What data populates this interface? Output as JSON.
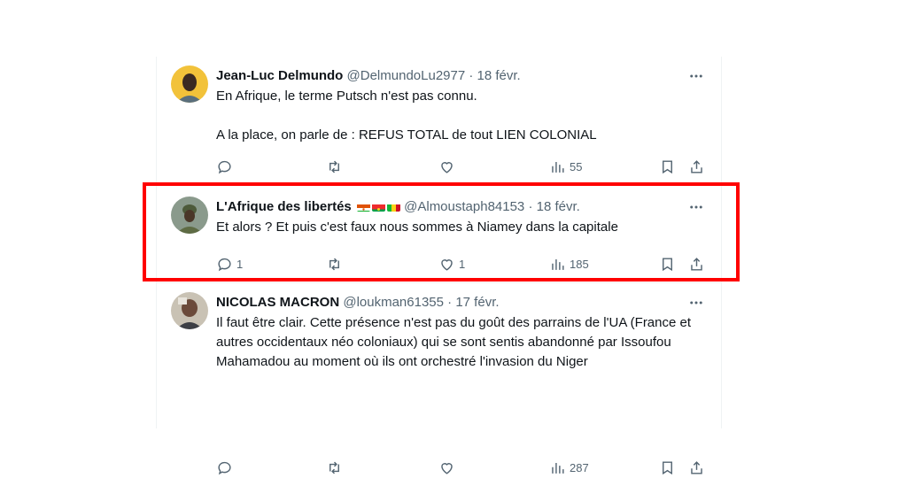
{
  "tweets": [
    {
      "name": "Jean-Luc Delmundo",
      "handle": "@DelmundoLu2977",
      "separator": "·",
      "date": "18 févr.",
      "lines": [
        "En Afrique, le terme Putsch n'est pas connu.",
        "A la place, on parle de : REFUS TOTAL de tout LIEN COLONIAL"
      ],
      "reply_count": "",
      "like_count": "",
      "views": "55"
    },
    {
      "name": "L'Afrique des libertés",
      "handle": "@Almoustaph84153",
      "separator": "·",
      "date": "18 févr.",
      "lines": [
        "Et alors ? Et puis c'est faux nous sommes à Niamey dans la capitale"
      ],
      "reply_count": "1",
      "like_count": "1",
      "views": "185"
    },
    {
      "name": "NICOLAS MACRON",
      "handle": "@loukman61355",
      "separator": "·",
      "date": "17 févr.",
      "lines": [
        "Il faut être clair. Cette présence n'est pas du goût des parrains de l'UA (France et autres occidentaux néo coloniaux) qui se sont sentis abandonné par Issoufou Mahamadou au moment où ils ont orchestré l'invasion du Niger"
      ],
      "reply_count": "",
      "like_count": "",
      "views": "287"
    }
  ],
  "flags": [
    "niger-flag",
    "burkina-faso-flag",
    "mali-flag"
  ],
  "highlight_color": "#ff0000",
  "text_secondary": "#536471"
}
